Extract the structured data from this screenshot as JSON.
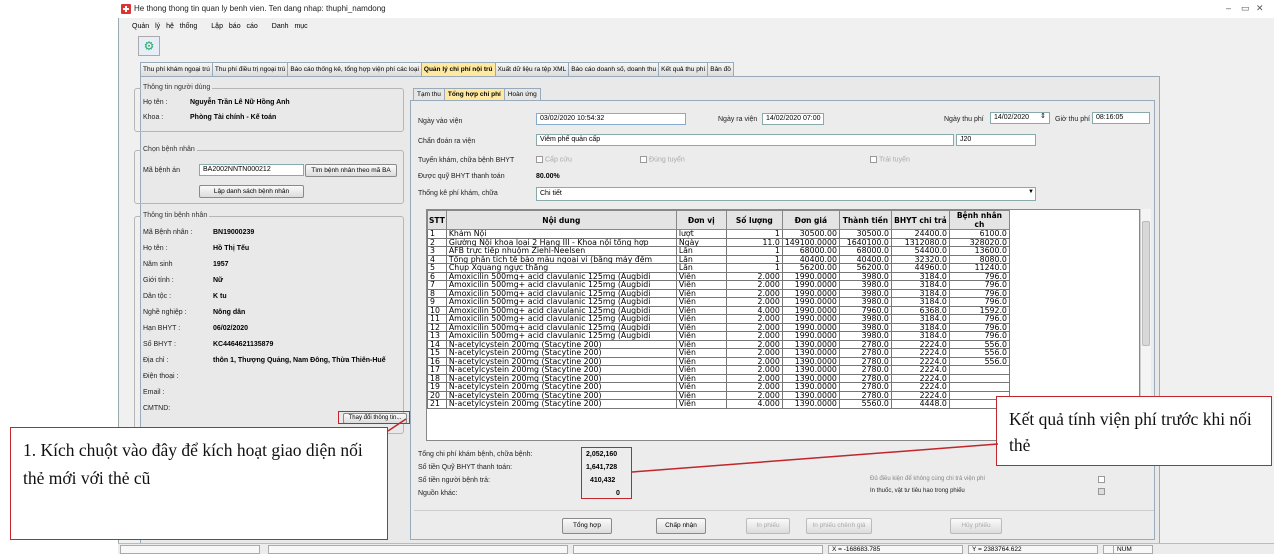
{
  "window": {
    "title": "He thong thong tin quan ly benh vien. Ten dang nhap: thuphi_namdong"
  },
  "menu": [
    "Quản lý hệ thống",
    "Lập báo cáo",
    "Danh mục"
  ],
  "main_tabs": [
    "Thu phí khám ngoại trú",
    "Thu phí điều trị ngoại trú",
    "Báo cáo thống kê, tổng hợp viện phí các loại",
    "Quản lý chi phí nội trú",
    "Xuất dữ liệu ra tệp XML",
    "Báo cáo doanh số, doanh thu",
    "Kết quả thu phí",
    "Bản đồ"
  ],
  "user_info": {
    "title": "Thông tin người dùng",
    "name_label": "Họ tên :",
    "name": "Nguyễn Trần Lê Nữ Hồng Anh",
    "dept_label": "Khoa :",
    "dept": "Phòng Tài chính - Kế toán"
  },
  "choose_patient": {
    "title": "Chọn bệnh nhân",
    "record_label": "Mã bệnh án",
    "record_value": "BA2002NNTN000212",
    "find_button": "Tìm bệnh nhân theo mã BA",
    "list_button": "Lập danh sách bệnh nhân"
  },
  "patient": {
    "title": "Thông tin bệnh nhân",
    "fields": [
      {
        "label": "Mã Bệnh nhân :",
        "value": "BN19000239"
      },
      {
        "label": "Họ tên :",
        "value": "Hồ Thị Tếu"
      },
      {
        "label": "Năm sinh",
        "value": "1957"
      },
      {
        "label": "Giới tính :",
        "value": "Nữ"
      },
      {
        "label": "Dân tộc :",
        "value": "K tu"
      },
      {
        "label": "Nghề nghiệp :",
        "value": "Nông dân"
      },
      {
        "label": "Hạn BHYT :",
        "value": "06/02/2020"
      },
      {
        "label": "Số BHYT :",
        "value": "KC4464621135879"
      },
      {
        "label": "Địa chỉ :",
        "value": "thôn 1, Thượng Quảng, Nam Đông, Thừa Thiên-Huế"
      },
      {
        "label": "Điện thoại :",
        "value": ""
      },
      {
        "label": "Email :",
        "value": ""
      },
      {
        "label": "CMTND:",
        "value": ""
      }
    ],
    "edit_button": "Thay đổi thông tin..."
  },
  "sub_tabs": [
    "Tạm thu",
    "Tổng hợp chi phí",
    "Hoàn ứng"
  ],
  "form": {
    "admit_label": "Ngày vào viện",
    "admit_value": "03/02/2020 10:54:32",
    "discharge_label": "Ngày ra viện",
    "discharge_value": "14/02/2020 07:00",
    "pay_date_label": "Ngày thu phí",
    "pay_date_value": "14/02/2020",
    "pay_time_label": "Giờ thu phí",
    "pay_time_value": "08:16:05",
    "diag_label": "Chẩn đoán ra viện",
    "diag_value": "Viêm phế quản cấp",
    "diag_code": "J20",
    "route_label": "Tuyến khám, chữa bệnh BHYT",
    "route_emergency": "Cấp cứu",
    "route_correct": "Đúng tuyến",
    "route_wrong": "Trái tuyến",
    "coverage_label": "Được quỹ BHYT thanh toán",
    "coverage_value": "80.00%",
    "stat_label": "Thống kê phí khám, chữa",
    "stat_value": "Chi tiết"
  },
  "grid": {
    "headers": [
      "STT",
      "Nội dung",
      "Đơn vị",
      "Số lượng",
      "Đơn giá",
      "Thành tiền",
      "BHYT chi trả",
      "Bệnh nhân ch"
    ],
    "rows": [
      [
        "1",
        "Khám Nội",
        "lượt",
        "1",
        "30500.00",
        "30500.0",
        "24400.0",
        "6100.0"
      ],
      [
        "2",
        "Giường Nội khoa loại 2 Hạng III - Khoa nội tổng hợp",
        "Ngày",
        "11.0",
        "149100.0000",
        "1640100.0",
        "1312080.0",
        "328020.0"
      ],
      [
        "3",
        "AFB trực tiếp nhuộm Ziehl-Neelsen",
        "Lần",
        "1",
        "68000.00",
        "68000.0",
        "54400.0",
        "13600.0"
      ],
      [
        "4",
        "Tổng phân tích tế bào máu ngoại vi (bằng máy đếm",
        "Lần",
        "1",
        "40400.00",
        "40400.0",
        "32320.0",
        "8080.0"
      ],
      [
        "5",
        "Chụp Xquang ngực thẳng",
        "Lần",
        "1",
        "56200.00",
        "56200.0",
        "44960.0",
        "11240.0"
      ],
      [
        "6",
        "Amoxicilin 500mg+ acid clavulanic 125mg (Augbidi",
        "Viên",
        "2.000",
        "1990.0000",
        "3980.0",
        "3184.0",
        "796.0"
      ],
      [
        "7",
        "Amoxicilin 500mg+ acid clavulanic 125mg (Augbidi",
        "Viên",
        "2.000",
        "1990.0000",
        "3980.0",
        "3184.0",
        "796.0"
      ],
      [
        "8",
        "Amoxicilin 500mg+ acid clavulanic 125mg (Augbidi",
        "Viên",
        "2.000",
        "1990.0000",
        "3980.0",
        "3184.0",
        "796.0"
      ],
      [
        "9",
        "Amoxicilin 500mg+ acid clavulanic 125mg (Augbidi",
        "Viên",
        "2.000",
        "1990.0000",
        "3980.0",
        "3184.0",
        "796.0"
      ],
      [
        "10",
        "Amoxicilin 500mg+ acid clavulanic 125mg (Augbidi",
        "Viên",
        "4.000",
        "1990.0000",
        "7960.0",
        "6368.0",
        "1592.0"
      ],
      [
        "11",
        "Amoxicilin 500mg+ acid clavulanic 125mg (Augbidi",
        "Viên",
        "2.000",
        "1990.0000",
        "3980.0",
        "3184.0",
        "796.0"
      ],
      [
        "12",
        "Amoxicilin 500mg+ acid clavulanic 125mg (Augbidi",
        "Viên",
        "2.000",
        "1990.0000",
        "3980.0",
        "3184.0",
        "796.0"
      ],
      [
        "13",
        "Amoxicilin 500mg+ acid clavulanic 125mg (Augbidi",
        "Viên",
        "2.000",
        "1990.0000",
        "3980.0",
        "3184.0",
        "796.0"
      ],
      [
        "14",
        "N-acetylcystein 200mg (Stacytine 200)",
        "Viên",
        "2.000",
        "1390.0000",
        "2780.0",
        "2224.0",
        "556.0"
      ],
      [
        "15",
        "N-acetylcystein 200mg (Stacytine 200)",
        "Viên",
        "2.000",
        "1390.0000",
        "2780.0",
        "2224.0",
        "556.0"
      ],
      [
        "16",
        "N-acetylcystein 200mg (Stacytine 200)",
        "Viên",
        "2.000",
        "1390.0000",
        "2780.0",
        "2224.0",
        "556.0"
      ],
      [
        "17",
        "N-acetylcystein 200mg (Stacytine 200)",
        "Viên",
        "2.000",
        "1390.0000",
        "2780.0",
        "2224.0",
        ""
      ],
      [
        "18",
        "N-acetylcystein 200mg (Stacytine 200)",
        "Viên",
        "2.000",
        "1390.0000",
        "2780.0",
        "2224.0",
        ""
      ],
      [
        "19",
        "N-acetylcystein 200mg (Stacytine 200)",
        "Viên",
        "2.000",
        "1390.0000",
        "2780.0",
        "2224.0",
        ""
      ],
      [
        "20",
        "N-acetylcystein 200mg (Stacytine 200)",
        "Viên",
        "2.000",
        "1390.0000",
        "2780.0",
        "2224.0",
        ""
      ],
      [
        "21",
        "N-acetylcystein 200mg (Stacytine 200)",
        "Viên",
        "4.000",
        "1390.0000",
        "5560.0",
        "4448.0",
        ""
      ]
    ]
  },
  "totals": {
    "total_label": "Tổng chi phí khám bệnh, chữa bệnh:",
    "total_value": "2,052,160",
    "bhyt_label": "Số tiền Quỹ BHYT thanh toán:",
    "bhyt_value": "1,641,728",
    "patient_label": "Số tiền người bệnh trả:",
    "patient_value": "410,432",
    "other_label": "Nguồn khác:",
    "other_value": "0",
    "opt1": "Đủ điều kiện để không cùng chi trả viện phí",
    "opt2": "In thuốc, vật tư tiêu hao trong phiếu"
  },
  "buttons": {
    "summary": "Tổng hợp",
    "accept": "Chấp nhận",
    "print": "In phiếu",
    "print_detail": "In phiếu chênh giá",
    "cancel": "Hủy phiếu"
  },
  "status": {
    "x": "X = -168683.785",
    "y": "Y = 2383764.622",
    "num": "NUM"
  },
  "callouts": {
    "left": "1. Kích chuột vào đây để kích hoạt giao diện nối thẻ mới với thẻ cũ",
    "right": "Kết quả tính viện phí trước khi nối thẻ"
  },
  "colors": {
    "callout_border": "#c0262b",
    "active_tab": "#ffe9a0"
  }
}
